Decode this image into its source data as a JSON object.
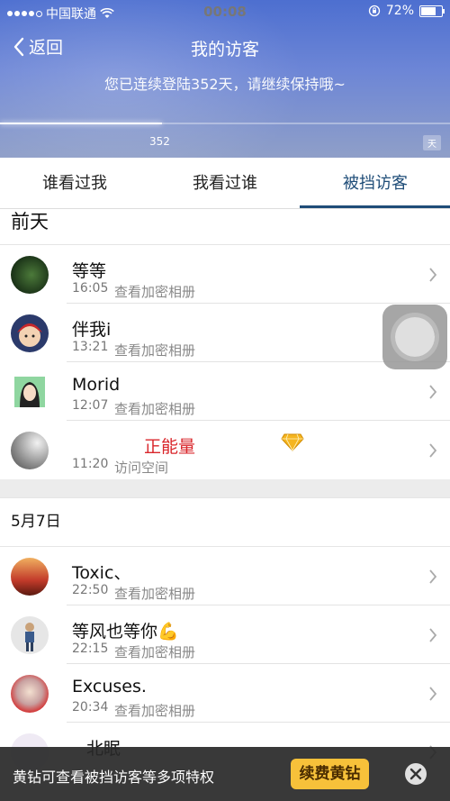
{
  "status_bar": {
    "carrier": "中国联通",
    "time": "00:08",
    "battery": "72%",
    "battery_level": 0.72,
    "signal_bars_filled": 4,
    "signal_bars_total": 5
  },
  "nav": {
    "back_label": "返回",
    "title": "我的访客"
  },
  "header": {
    "login_message": "您已连续登陆352天，请继续保持哦~",
    "progress_value": 352,
    "progress_fraction": 0.36,
    "unit_badge": "天"
  },
  "tabs": [
    {
      "label": "谁看过我"
    },
    {
      "label": "我看过谁"
    },
    {
      "label": "被挡访客",
      "active": true
    }
  ],
  "sections": [
    {
      "title": "前天",
      "items": [
        {
          "name": "等等",
          "time": "16:05",
          "action": "查看加密相册",
          "avatar": "forest-avatar"
        },
        {
          "name": "伴我i",
          "time": "13:21",
          "action": "查看加密相册",
          "avatar": "cartoon-avatar"
        },
        {
          "name": "Morid",
          "time": "12:07",
          "action": "查看加密相册",
          "avatar": "anime-avatar"
        },
        {
          "name": "正能量",
          "time": "11:20",
          "action": "访问空间",
          "avatar": "gray-avatar",
          "vip": true
        }
      ]
    },
    {
      "title": "5月7日",
      "items": [
        {
          "name": "Toxic、",
          "time": "22:50",
          "action": "查看加密相册",
          "avatar": "sunset-avatar"
        },
        {
          "name": "等风也等你💪",
          "time": "22:15",
          "action": "查看加密相册",
          "avatar": "person-avatar"
        },
        {
          "name": "Excuses.",
          "time": "20:34",
          "action": "查看加密相册",
          "avatar": "girl-avatar"
        },
        {
          "name": "北眠",
          "time": "",
          "action": "",
          "avatar": "partial-avatar"
        }
      ]
    }
  ],
  "banner": {
    "text": "黄钻可查看被挡访客等多项特权",
    "button": "续费黄钻"
  },
  "colors": {
    "header_top": "#4d6fd0",
    "active_tab": "#1f4d78",
    "vip_name": "#d9262b",
    "banner_button": "#f7c13a"
  }
}
